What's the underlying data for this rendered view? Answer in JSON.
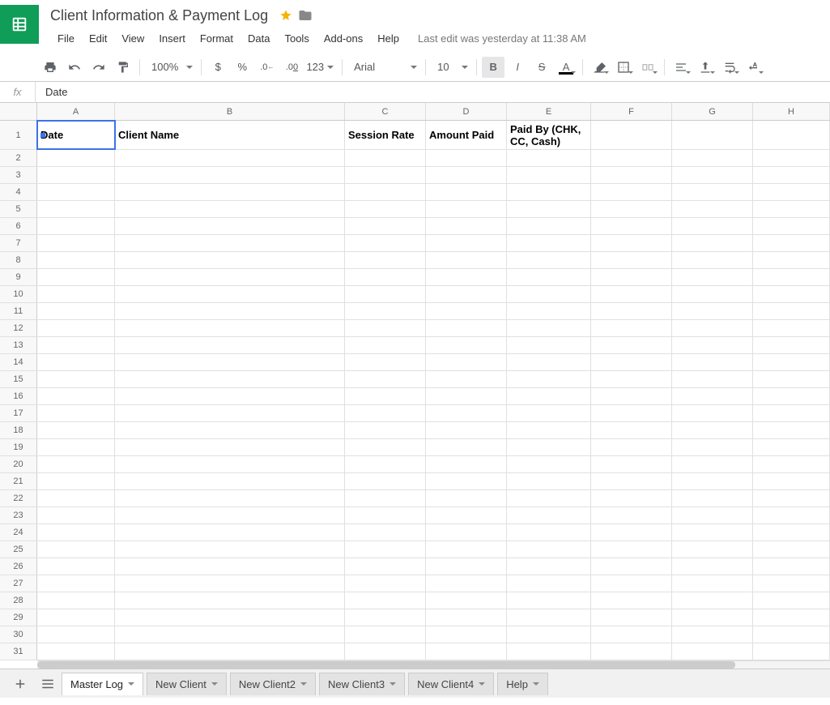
{
  "header": {
    "title": "Client Information & Payment Log",
    "starred": true,
    "last_edit": "Last edit was yesterday at 11:38 AM"
  },
  "menu": {
    "file": "File",
    "edit": "Edit",
    "view": "View",
    "insert": "Insert",
    "format": "Format",
    "data": "Data",
    "tools": "Tools",
    "addons": "Add-ons",
    "help": "Help"
  },
  "toolbar": {
    "zoom": "100%",
    "currency": "$",
    "percent": "%",
    "dec_dec": ".0",
    "inc_dec": ".00",
    "numfmt": "123",
    "font": "Arial",
    "font_size": "10",
    "bold": "B",
    "italic": "I",
    "strike": "S",
    "textcolor_letter": "A"
  },
  "formula_bar": {
    "fx_label": "fx",
    "value": "Date"
  },
  "grid": {
    "columns": [
      "A",
      "B",
      "C",
      "D",
      "E",
      "F",
      "G",
      "H"
    ],
    "row_count": 31,
    "selected_cell": "A1",
    "headers_row": {
      "A": "Date",
      "B": "Client Name",
      "C": "Session Rate",
      "D": "Amount Paid",
      "E": "Paid By (CHK, CC, Cash)",
      "F": "",
      "G": "",
      "H": ""
    }
  },
  "sheet_tabs": [
    {
      "label": "Master Log",
      "active": true
    },
    {
      "label": "New Client",
      "active": false
    },
    {
      "label": "New Client2",
      "active": false
    },
    {
      "label": "New Client3",
      "active": false
    },
    {
      "label": "New Client4",
      "active": false
    },
    {
      "label": "Help",
      "active": false
    }
  ]
}
